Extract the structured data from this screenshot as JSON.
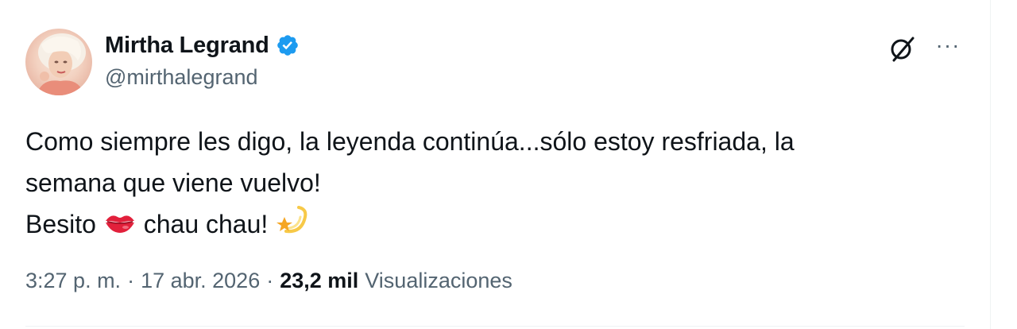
{
  "author": {
    "display_name": "Mirtha Legrand",
    "handle": "@mirthalegrand",
    "verified_icon": "verified-badge-icon",
    "verified_color": "#1d9bf0"
  },
  "actions": {
    "grok_icon": "grok-icon",
    "more_icon": "more-options-icon",
    "more_label": "···"
  },
  "tweet": {
    "line1": "Como siempre les digo, la leyenda continúa...sólo estoy resfriada, la",
    "line2": "semana que viene vuelvo!",
    "line3_before": "Besito",
    "line3_after": "chau chau!",
    "emoji1": "kiss-mark-emoji",
    "emoji2": "dizzy-star-emoji"
  },
  "meta": {
    "time": "3:27 p. m.",
    "separator": "·",
    "date": "17 abr. 2026",
    "views_count": "23,2 mil",
    "views_label": "Visualizaciones"
  },
  "colors": {
    "text": "#0f1419",
    "secondary": "#536471",
    "accent": "#1d9bf0",
    "divider": "#eff3f4"
  }
}
